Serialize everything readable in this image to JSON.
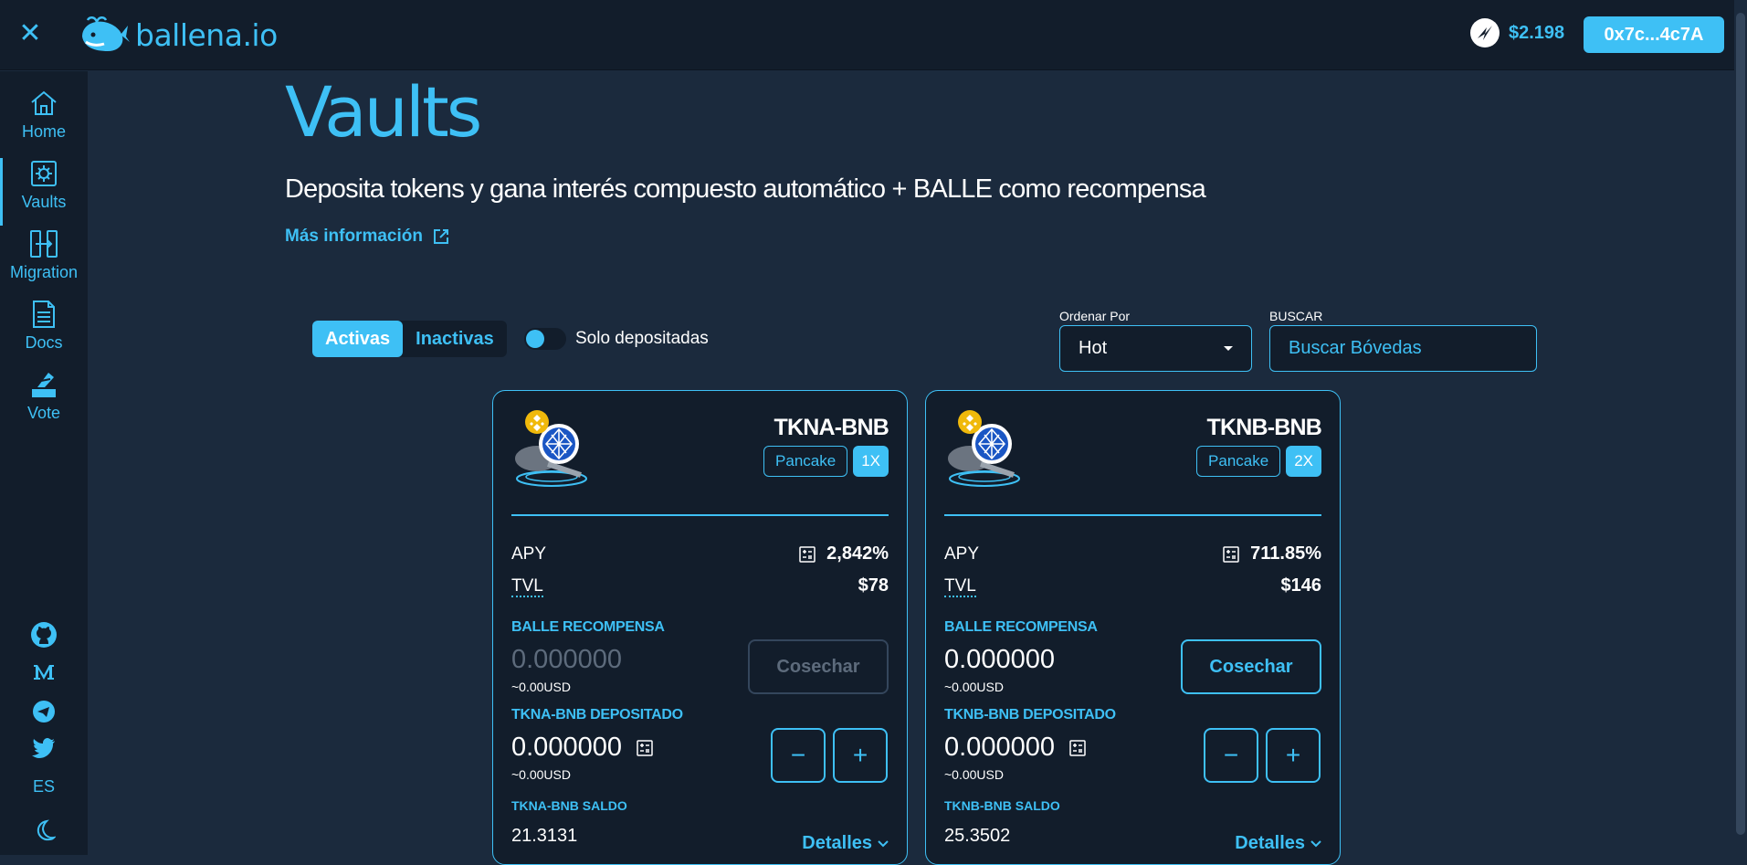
{
  "header": {
    "brand": "ballena.io",
    "token_price": "$2.198",
    "wallet_address": "0x7c...4c7A"
  },
  "sidebar": {
    "items": [
      {
        "label": "Home",
        "icon": "home-icon"
      },
      {
        "label": "Vaults",
        "icon": "vault-icon",
        "active": true
      },
      {
        "label": "Migration",
        "icon": "migration-icon"
      },
      {
        "label": "Docs",
        "icon": "docs-icon"
      },
      {
        "label": "Vote",
        "icon": "vote-icon"
      }
    ],
    "socials": [
      "github-icon",
      "medium-icon",
      "telegram-icon",
      "twitter-icon"
    ],
    "language": "ES",
    "theme_icon": "moon-icon"
  },
  "page": {
    "title": "Vaults",
    "subtitle": "Deposita tokens y gana interés compuesto automático + BALLE como recompensa",
    "more_info": "Más información"
  },
  "filters": {
    "tabs": [
      {
        "label": "Activas",
        "active": true
      },
      {
        "label": "Inactivas",
        "active": false
      }
    ],
    "toggle_label": "Solo depositadas",
    "sort_label": "Ordenar Por",
    "sort_value": "Hot",
    "search_label": "BUSCAR",
    "search_placeholder": "Buscar Bóvedas"
  },
  "vaults": [
    {
      "name": "TKNA-BNB",
      "platform": "Pancake",
      "multiplier": "1X",
      "apy_label": "APY",
      "apy": "2,842%",
      "tvl_label": "TVL",
      "tvl": "$78",
      "reward_title": "BALLE RECOMPENSA",
      "reward_amount": "0.000000",
      "reward_usd": "~0.00USD",
      "harvest_label": "Cosechar",
      "harvest_enabled": false,
      "deposit_title": "TKNA-BNB DEPOSITADO",
      "deposit_amount": "0.000000",
      "deposit_usd": "~0.00USD",
      "balance_title": "TKNA-BNB SALDO",
      "balance": "21.3131",
      "details_label": "Detalles"
    },
    {
      "name": "TKNB-BNB",
      "platform": "Pancake",
      "multiplier": "2X",
      "apy_label": "APY",
      "apy": "711.85%",
      "tvl_label": "TVL",
      "tvl": "$146",
      "reward_title": "BALLE RECOMPENSA",
      "reward_amount": "0.000000",
      "reward_usd": "~0.00USD",
      "harvest_label": "Cosechar",
      "harvest_enabled": true,
      "deposit_title": "TKNB-BNB DEPOSITADO",
      "deposit_amount": "0.000000",
      "deposit_usd": "~0.00USD",
      "balance_title": "TKNB-BNB SALDO",
      "balance": "25.3502",
      "details_label": "Detalles"
    }
  ],
  "colors": {
    "accent": "#3ec0f5",
    "background": "#1b2a3d",
    "panel": "#121d2b",
    "bnb_yellow": "#f0b90b"
  }
}
